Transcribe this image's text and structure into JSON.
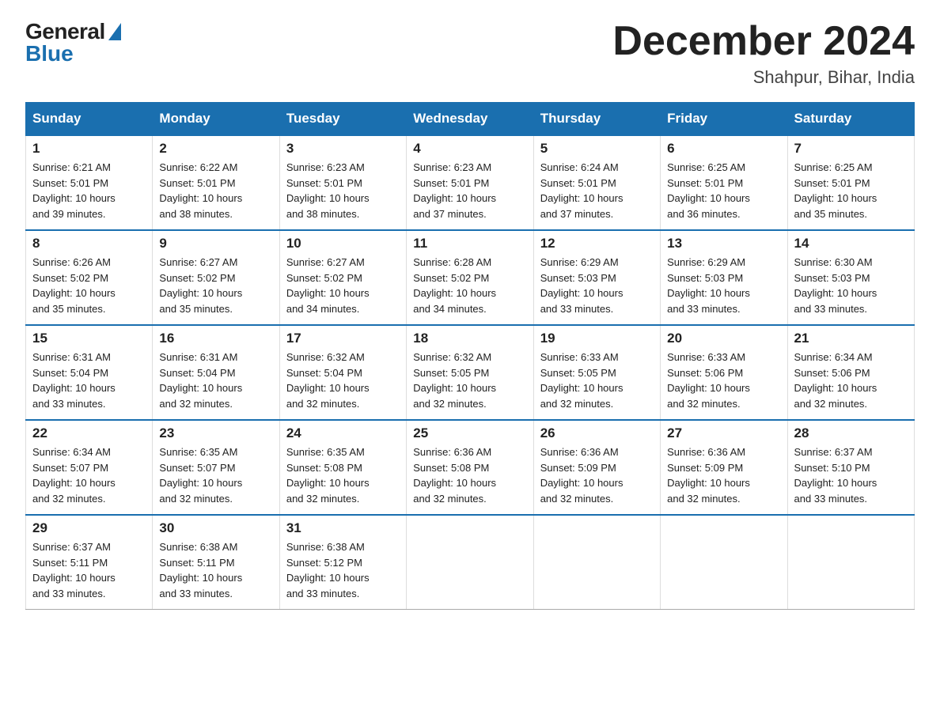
{
  "header": {
    "title": "December 2024",
    "subtitle": "Shahpur, Bihar, India",
    "logo_general": "General",
    "logo_blue": "Blue"
  },
  "days_of_week": [
    "Sunday",
    "Monday",
    "Tuesday",
    "Wednesday",
    "Thursday",
    "Friday",
    "Saturday"
  ],
  "weeks": [
    [
      {
        "num": "1",
        "sunrise": "6:21 AM",
        "sunset": "5:01 PM",
        "daylight": "10 hours and 39 minutes."
      },
      {
        "num": "2",
        "sunrise": "6:22 AM",
        "sunset": "5:01 PM",
        "daylight": "10 hours and 38 minutes."
      },
      {
        "num": "3",
        "sunrise": "6:23 AM",
        "sunset": "5:01 PM",
        "daylight": "10 hours and 38 minutes."
      },
      {
        "num": "4",
        "sunrise": "6:23 AM",
        "sunset": "5:01 PM",
        "daylight": "10 hours and 37 minutes."
      },
      {
        "num": "5",
        "sunrise": "6:24 AM",
        "sunset": "5:01 PM",
        "daylight": "10 hours and 37 minutes."
      },
      {
        "num": "6",
        "sunrise": "6:25 AM",
        "sunset": "5:01 PM",
        "daylight": "10 hours and 36 minutes."
      },
      {
        "num": "7",
        "sunrise": "6:25 AM",
        "sunset": "5:01 PM",
        "daylight": "10 hours and 35 minutes."
      }
    ],
    [
      {
        "num": "8",
        "sunrise": "6:26 AM",
        "sunset": "5:02 PM",
        "daylight": "10 hours and 35 minutes."
      },
      {
        "num": "9",
        "sunrise": "6:27 AM",
        "sunset": "5:02 PM",
        "daylight": "10 hours and 35 minutes."
      },
      {
        "num": "10",
        "sunrise": "6:27 AM",
        "sunset": "5:02 PM",
        "daylight": "10 hours and 34 minutes."
      },
      {
        "num": "11",
        "sunrise": "6:28 AM",
        "sunset": "5:02 PM",
        "daylight": "10 hours and 34 minutes."
      },
      {
        "num": "12",
        "sunrise": "6:29 AM",
        "sunset": "5:03 PM",
        "daylight": "10 hours and 33 minutes."
      },
      {
        "num": "13",
        "sunrise": "6:29 AM",
        "sunset": "5:03 PM",
        "daylight": "10 hours and 33 minutes."
      },
      {
        "num": "14",
        "sunrise": "6:30 AM",
        "sunset": "5:03 PM",
        "daylight": "10 hours and 33 minutes."
      }
    ],
    [
      {
        "num": "15",
        "sunrise": "6:31 AM",
        "sunset": "5:04 PM",
        "daylight": "10 hours and 33 minutes."
      },
      {
        "num": "16",
        "sunrise": "6:31 AM",
        "sunset": "5:04 PM",
        "daylight": "10 hours and 32 minutes."
      },
      {
        "num": "17",
        "sunrise": "6:32 AM",
        "sunset": "5:04 PM",
        "daylight": "10 hours and 32 minutes."
      },
      {
        "num": "18",
        "sunrise": "6:32 AM",
        "sunset": "5:05 PM",
        "daylight": "10 hours and 32 minutes."
      },
      {
        "num": "19",
        "sunrise": "6:33 AM",
        "sunset": "5:05 PM",
        "daylight": "10 hours and 32 minutes."
      },
      {
        "num": "20",
        "sunrise": "6:33 AM",
        "sunset": "5:06 PM",
        "daylight": "10 hours and 32 minutes."
      },
      {
        "num": "21",
        "sunrise": "6:34 AM",
        "sunset": "5:06 PM",
        "daylight": "10 hours and 32 minutes."
      }
    ],
    [
      {
        "num": "22",
        "sunrise": "6:34 AM",
        "sunset": "5:07 PM",
        "daylight": "10 hours and 32 minutes."
      },
      {
        "num": "23",
        "sunrise": "6:35 AM",
        "sunset": "5:07 PM",
        "daylight": "10 hours and 32 minutes."
      },
      {
        "num": "24",
        "sunrise": "6:35 AM",
        "sunset": "5:08 PM",
        "daylight": "10 hours and 32 minutes."
      },
      {
        "num": "25",
        "sunrise": "6:36 AM",
        "sunset": "5:08 PM",
        "daylight": "10 hours and 32 minutes."
      },
      {
        "num": "26",
        "sunrise": "6:36 AM",
        "sunset": "5:09 PM",
        "daylight": "10 hours and 32 minutes."
      },
      {
        "num": "27",
        "sunrise": "6:36 AM",
        "sunset": "5:09 PM",
        "daylight": "10 hours and 32 minutes."
      },
      {
        "num": "28",
        "sunrise": "6:37 AM",
        "sunset": "5:10 PM",
        "daylight": "10 hours and 33 minutes."
      }
    ],
    [
      {
        "num": "29",
        "sunrise": "6:37 AM",
        "sunset": "5:11 PM",
        "daylight": "10 hours and 33 minutes."
      },
      {
        "num": "30",
        "sunrise": "6:38 AM",
        "sunset": "5:11 PM",
        "daylight": "10 hours and 33 minutes."
      },
      {
        "num": "31",
        "sunrise": "6:38 AM",
        "sunset": "5:12 PM",
        "daylight": "10 hours and 33 minutes."
      },
      null,
      null,
      null,
      null
    ]
  ],
  "labels": {
    "sunrise": "Sunrise:",
    "sunset": "Sunset:",
    "daylight": "Daylight:"
  }
}
